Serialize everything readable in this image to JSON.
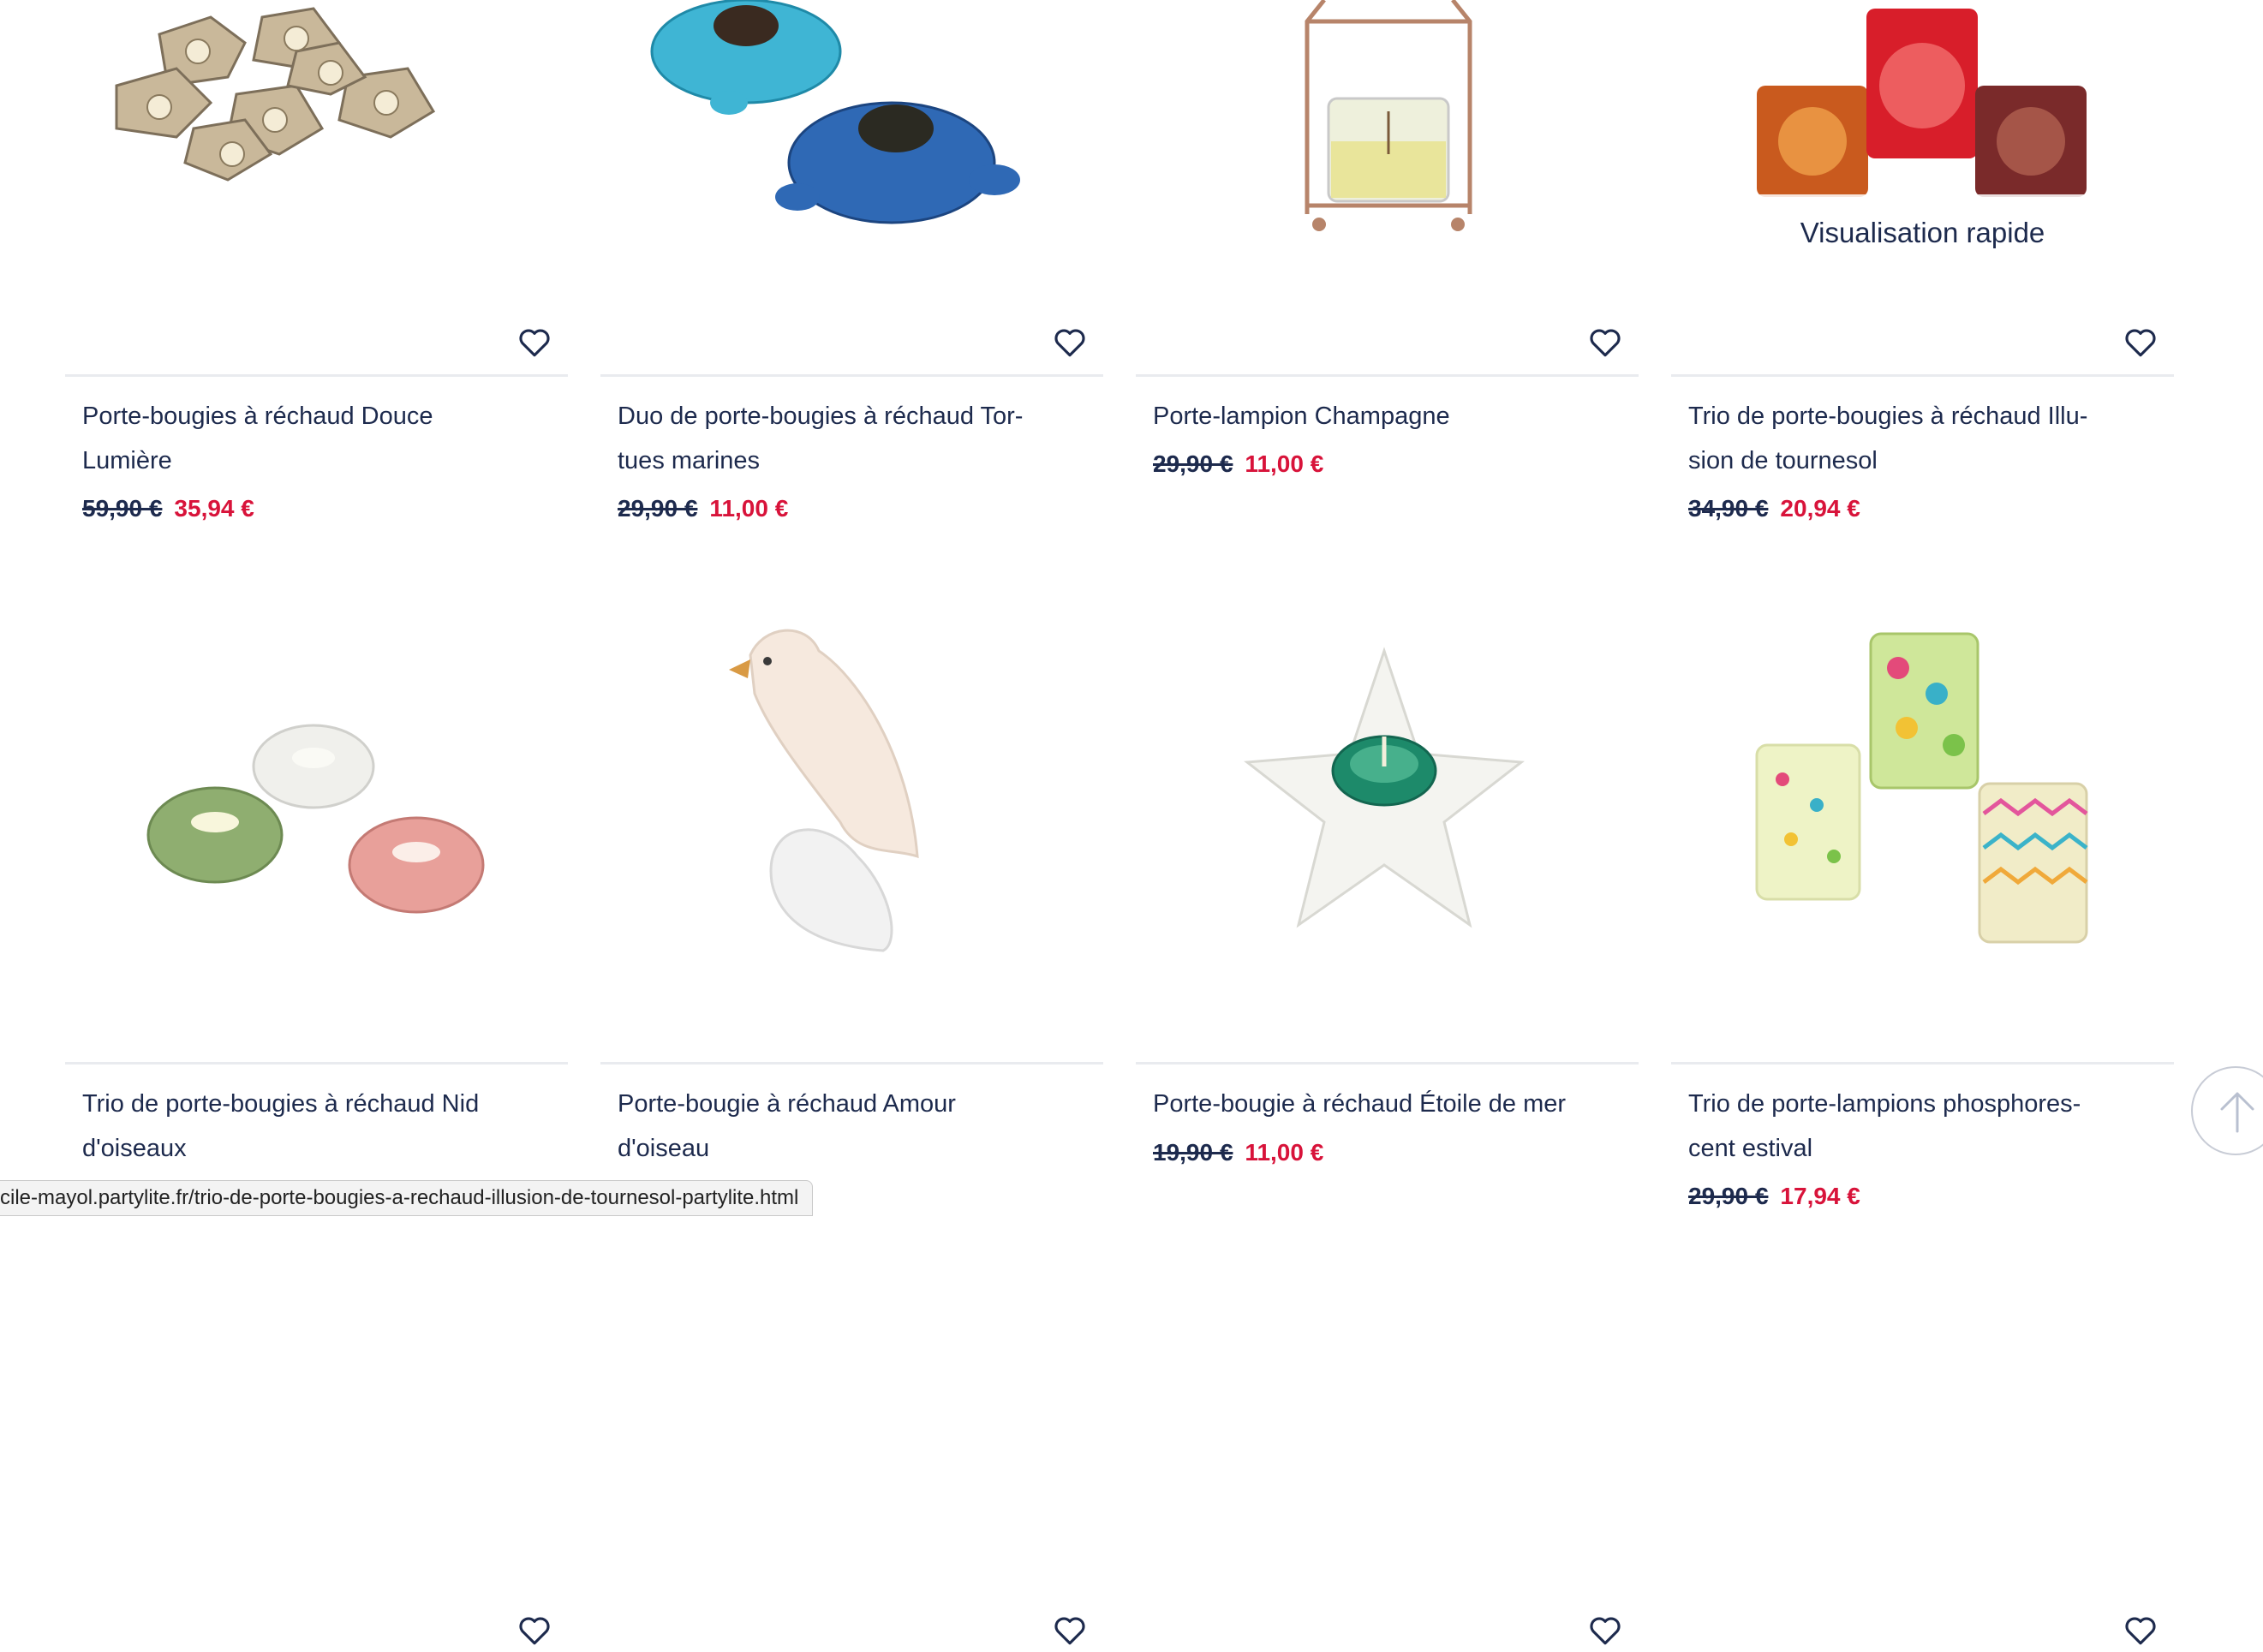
{
  "products": [
    {
      "title": "Porte-bougies à réchaud Douce\nLumière",
      "old_price": "59,90 €",
      "new_price": "35,94 €",
      "image": "tealight-holders-silver-shells"
    },
    {
      "title": "Duo de porte-bougies à réchaud Tor-\ntues marines",
      "old_price": "29,90 €",
      "new_price": "11,00 €",
      "image": "sea-turtle-tealight-holders"
    },
    {
      "title": "Porte-lampion Champagne",
      "old_price": "29,90 €",
      "new_price": "11,00 €",
      "image": "champagne-lantern"
    },
    {
      "title": "Trio de porte-bougies à réchaud Illu-\nsion de tournesol",
      "old_price": "34,90 €",
      "new_price": "20,94 €",
      "image": "sunflower-illusion-votives",
      "quick_view": "Visualisation rapide"
    },
    {
      "title": "Trio de porte-bougies à réchaud Nid\nd'oiseaux",
      "old_price": "",
      "new_price": "",
      "image": "bird-nest-tealight-holders"
    },
    {
      "title": "Porte-bougie à réchaud Amour\nd'oiseau",
      "old_price": "",
      "new_price": "",
      "image": "porcelain-bird-lamp"
    },
    {
      "title": "Porte-bougie à réchaud Étoile de mer",
      "old_price": "19,90 €",
      "new_price": "11,00 €",
      "image": "starfish-tealight-holder"
    },
    {
      "title": "Trio de porte-lampions phosphores-\ncent estival",
      "old_price": "29,90 €",
      "new_price": "17,94 €",
      "image": "summer-glow-votives"
    }
  ],
  "status_bar": {
    "url": "cile-mayol.partylite.fr/trio-de-porte-bougies-a-rechaud-illusion-de-tournesol-partylite.html"
  },
  "icons": {
    "wishlist": "heart-icon",
    "back_to_top": "arrow-up-icon"
  },
  "colors": {
    "text": "#1d2a4d",
    "sale_price": "#d8133a",
    "divider": "#e9ebef"
  }
}
